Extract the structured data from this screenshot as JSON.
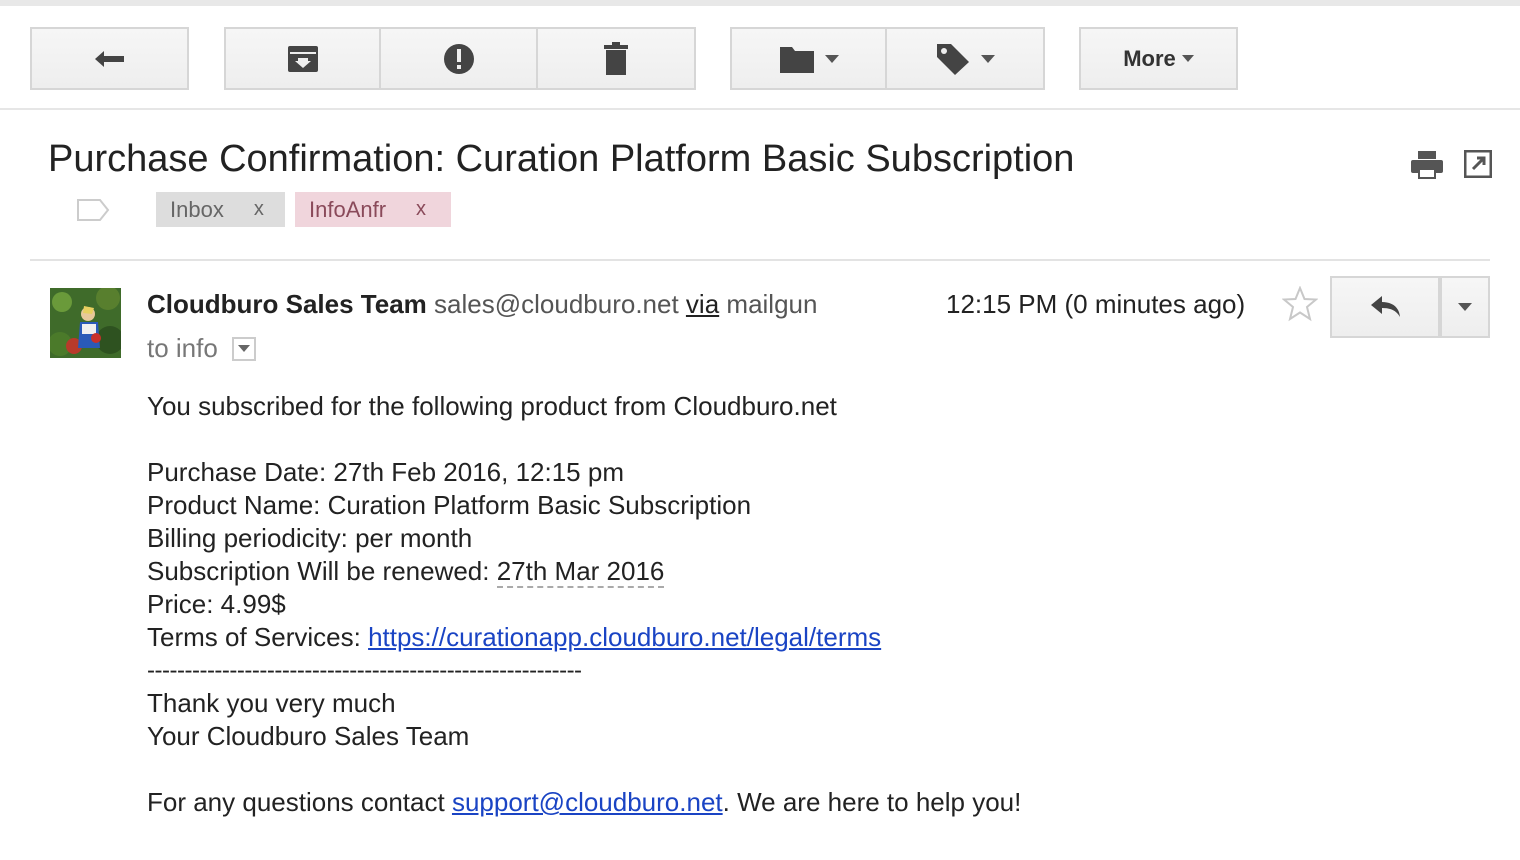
{
  "toolbar": {
    "more_label": "More",
    "icons": [
      "back-arrow-icon",
      "archive-icon",
      "report-spam-icon",
      "delete-icon",
      "folder-icon",
      "label-icon"
    ]
  },
  "email": {
    "subject": "Purchase Confirmation: Curation Platform Basic Subscription",
    "labels": [
      {
        "name": "Inbox",
        "remove": "x",
        "color": "#dddddd"
      },
      {
        "name": "InfoAnfr",
        "remove": "x",
        "color": "#f0d5dc"
      }
    ],
    "sender_name": "Cloudburo Sales Team",
    "sender_email": "sales@cloudburo.net",
    "via_label": "via",
    "via_domain": "mailgun",
    "to_line": "to info",
    "time": "12:15 PM (0 minutes ago)",
    "body": {
      "intro": "You subscribed for the following product from Cloudburo.net",
      "purchase_date": "Purchase Date: 27th Feb 2016, 12:15 pm",
      "product_name": "Product Name: Curation Platform Basic Subscription",
      "billing": "Billing periodicity: per month",
      "renewal_prefix": "Subscription Will be renewed: ",
      "renewal_date": "27th Mar 2016",
      "price": "Price: 4.99$",
      "terms_prefix": "Terms of Services: ",
      "terms_link": "https://curationapp.cloudburo.net/legal/terms",
      "separator": "----------------------------------------------------------",
      "thanks": "Thank you very much",
      "signature": "Your Cloudburo Sales Team",
      "contact_prefix": "For any questions contact ",
      "contact_link": "support@cloudburo.net",
      "contact_suffix": ". We are here to help you!"
    }
  },
  "colors": {
    "link": "#1a44c4",
    "inbox_chip": "#dddddd",
    "infoanfr_chip": "#f0d5dc"
  }
}
